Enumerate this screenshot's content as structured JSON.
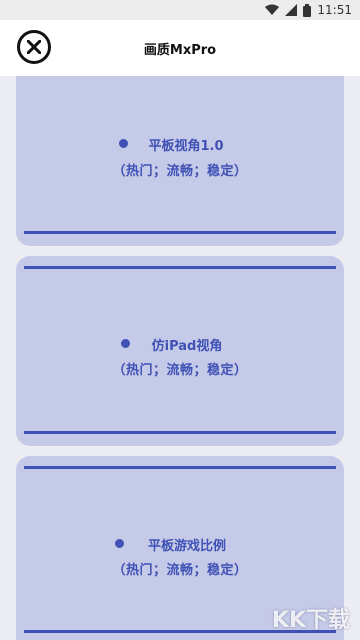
{
  "status_bar": {
    "time": "11:51",
    "icons": [
      "wifi-icon",
      "signal-icon",
      "battery-icon"
    ]
  },
  "header": {
    "title": "画质MxPro",
    "close_icon": "close-icon"
  },
  "colors": {
    "accent": "#3f51b5",
    "card_bg": "#c5cae8",
    "page_bg": "#ececf3"
  },
  "options": [
    {
      "name": "平板视角1.0",
      "tags": "（热门；流畅；稳定）"
    },
    {
      "name": "仿iPad视角",
      "tags": "（热门；流畅；稳定）"
    },
    {
      "name": "平板游戏比例",
      "tags": "（热门；流畅；稳定）"
    }
  ],
  "watermark": "KK下载"
}
